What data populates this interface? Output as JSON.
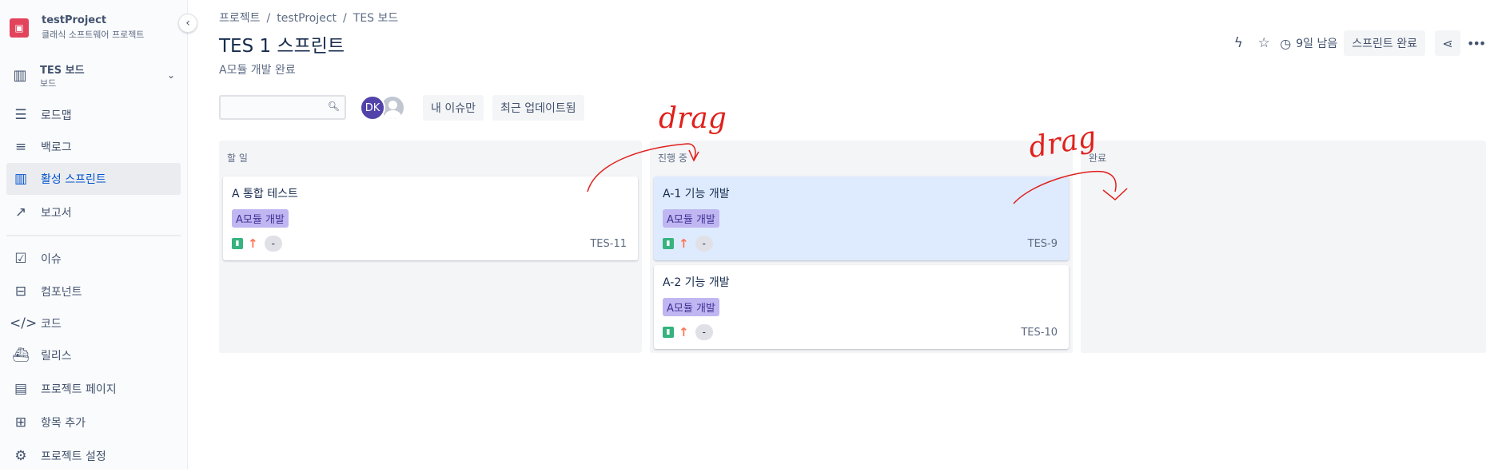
{
  "sidebar": {
    "project_name": "testProject",
    "project_type": "클래식 소프트웨어 프로젝트",
    "board_title": "TES 보드",
    "board_subtitle": "보드",
    "items": [
      {
        "label": "로드맵",
        "icon": "roadmap-icon"
      },
      {
        "label": "백로그",
        "icon": "backlog-icon"
      },
      {
        "label": "활성 스프린트",
        "icon": "board-columns-icon"
      },
      {
        "label": "보고서",
        "icon": "reports-chart-icon"
      },
      {
        "label": "이슈",
        "icon": "issues-icon"
      },
      {
        "label": "컴포넌트",
        "icon": "components-icon"
      },
      {
        "label": "코드",
        "icon": "code-icon"
      },
      {
        "label": "릴리스",
        "icon": "releases-ship-icon"
      },
      {
        "label": "프로젝트 페이지",
        "icon": "page-icon"
      },
      {
        "label": "항목 추가",
        "icon": "add-item-icon"
      },
      {
        "label": "프로젝트 설정",
        "icon": "gear-icon"
      }
    ]
  },
  "breadcrumb": [
    "프로젝트",
    "testProject",
    "TES 보드"
  ],
  "sprint": {
    "title": "TES 1 스프린트",
    "goal": "A모듈 개발 완료",
    "days_left": "9일 남음",
    "complete_label": "스프린트 완료"
  },
  "filters": {
    "avatar_initials": "DK",
    "only_my_issues": "내 이슈만",
    "recently_updated": "최근 업데이트됨"
  },
  "columns": [
    {
      "title": "할 일",
      "cards": [
        {
          "title": "A 통합 테스트",
          "epic": "A모듈 개발",
          "estimate": "-",
          "key": "TES-11",
          "selected": false
        }
      ]
    },
    {
      "title": "진행 중",
      "cards": [
        {
          "title": "A-1 기능 개발",
          "epic": "A모듈 개발",
          "estimate": "-",
          "key": "TES-9",
          "selected": true
        },
        {
          "title": "A-2 기능 개발",
          "epic": "A모듈 개발",
          "estimate": "-",
          "key": "TES-10",
          "selected": false
        }
      ]
    },
    {
      "title": "완료",
      "cards": []
    }
  ],
  "annotations": {
    "drag_1": "drag",
    "drag_2": "drag",
    "color": "#e0201b"
  }
}
